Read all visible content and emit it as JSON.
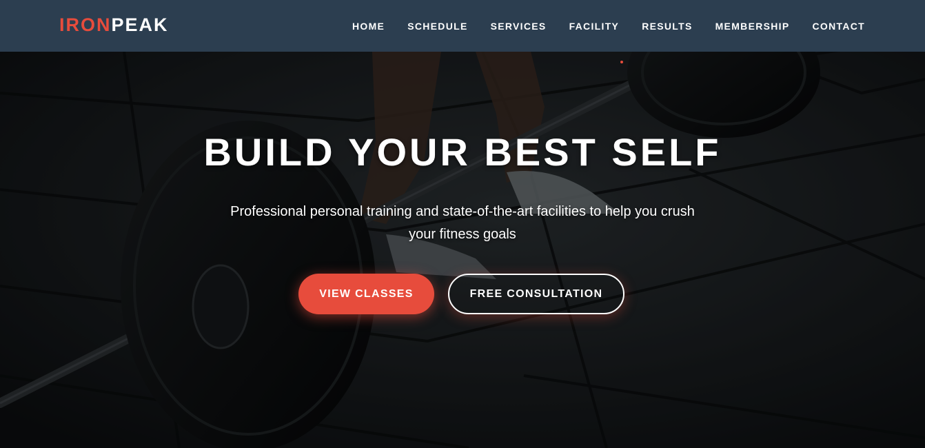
{
  "brand": {
    "part1": "IRON",
    "part2": "PEAK",
    "accent_color": "#e74c3c",
    "nav_bg": "#2c3e50"
  },
  "nav": {
    "items": [
      {
        "label": "HOME"
      },
      {
        "label": "SCHEDULE"
      },
      {
        "label": "SERVICES"
      },
      {
        "label": "FACILITY"
      },
      {
        "label": "RESULTS"
      },
      {
        "label": "MEMBERSHIP"
      },
      {
        "label": "CONTACT"
      }
    ]
  },
  "hero": {
    "title": "BUILD YOUR BEST SELF",
    "subtitle": "Professional personal training and state-of-the-art facilities to help you crush your fitness goals",
    "primary_cta": "VIEW CLASSES",
    "secondary_cta": "FREE CONSULTATION",
    "background_image": "barbell-deadlift-photo"
  }
}
